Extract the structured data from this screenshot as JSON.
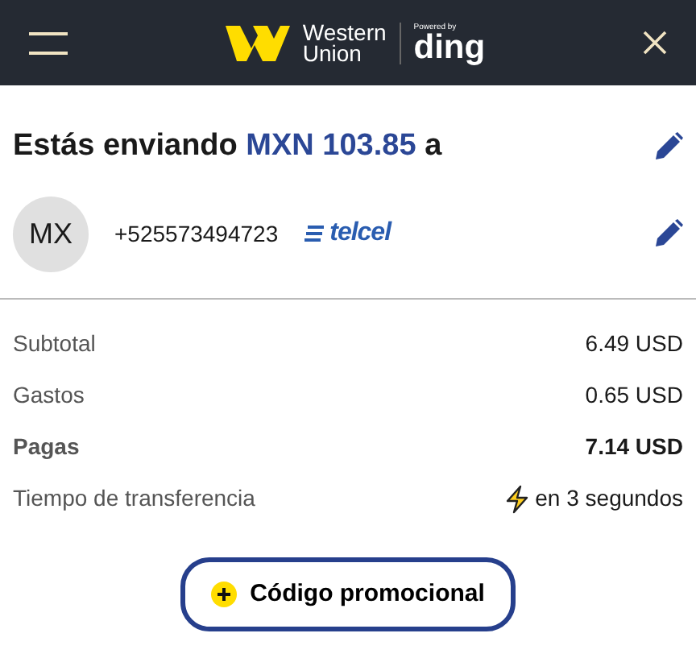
{
  "header": {
    "logo_lines": [
      "Western",
      "Union"
    ],
    "powered_by": "Powered by",
    "partner": "ding"
  },
  "heading": {
    "prefix": "Estás enviando",
    "amount": "MXN 103.85",
    "suffix": "a"
  },
  "recipient": {
    "avatar": "MX",
    "phone": "+525573494723",
    "operator": "telcel"
  },
  "summary": [
    {
      "label": "Subtotal",
      "value": "6.49 USD",
      "bold": false,
      "kind": "amount"
    },
    {
      "label": "Gastos",
      "value": "0.65 USD",
      "bold": false,
      "kind": "amount"
    },
    {
      "label": "Pagas",
      "value": "7.14 USD",
      "bold": true,
      "kind": "amount"
    },
    {
      "label": "Tiempo de transferencia",
      "value": "en 3 segundos",
      "bold": false,
      "kind": "time"
    }
  ],
  "promo_button": {
    "label": "Código promocional"
  }
}
